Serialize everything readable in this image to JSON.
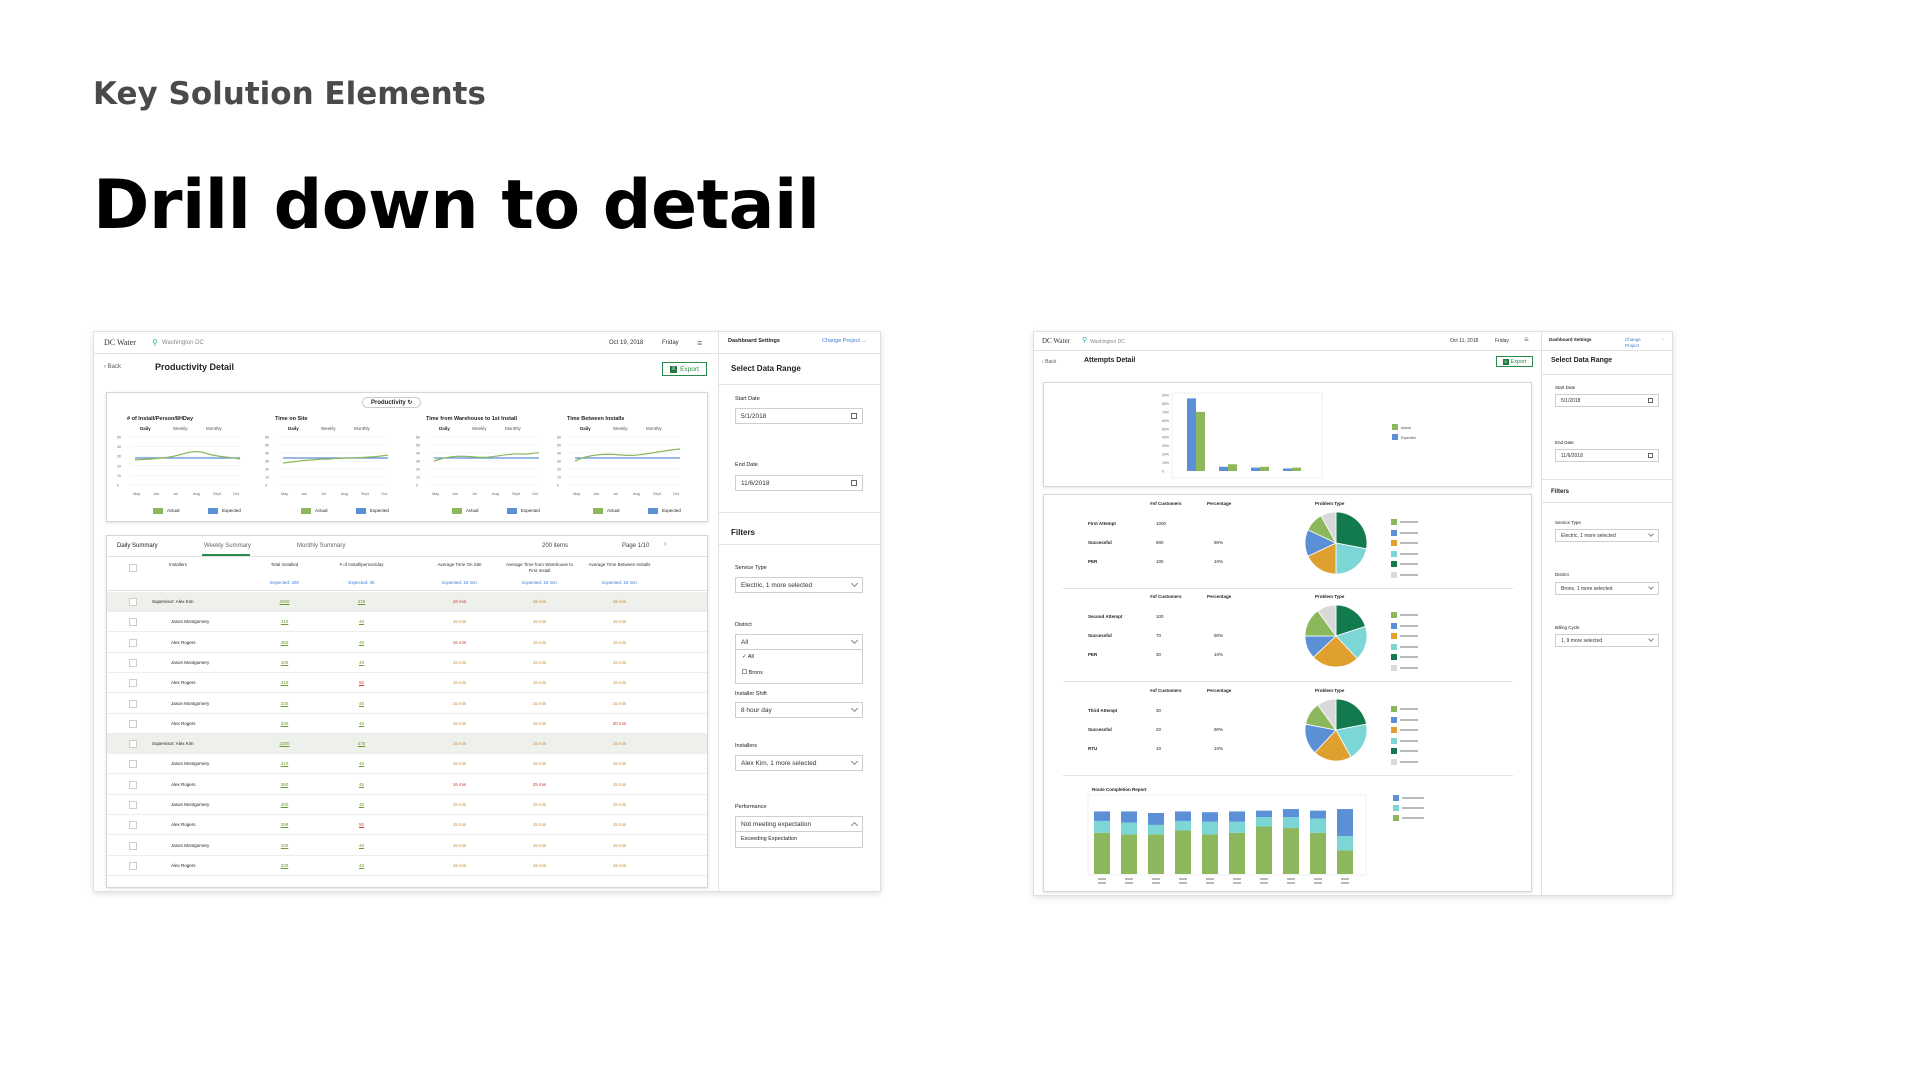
{
  "slide": {
    "kicker": "Key Solution Elements",
    "title": "Drill down to detail"
  },
  "colors": {
    "green": "#8db75c",
    "blue": "#5b8fd6",
    "teal": "#7dd6d6",
    "orange": "#e0a030",
    "darkgreen": "#127a4d",
    "grey": "#d9d9d9"
  },
  "productivity": {
    "app_name": "DC Water",
    "location": "Washington DC",
    "date": "Oct 19, 2018",
    "day": "Friday",
    "back": "Back",
    "page_title": "Productivity Detail",
    "export": "Export",
    "chip": "Productivity",
    "charts": [
      {
        "title": "# of Install/Person/8HDay",
        "tabs": [
          "Daily",
          "Weekly",
          "Monthly"
        ],
        "yticks": [
          "50",
          "40",
          "30",
          "20",
          "10",
          "0"
        ],
        "xticks": [
          "May",
          "Jun",
          "Jul",
          "Aug",
          "Sept",
          "Oct"
        ],
        "legend": [
          "Actual",
          "Expected"
        ]
      },
      {
        "title": "Time on Site",
        "tabs": [
          "Daily",
          "Weekly",
          "Monthly"
        ],
        "yticks": [
          "60",
          "50",
          "40",
          "30",
          "20",
          "10",
          "0"
        ],
        "xticks": [
          "May",
          "Jun",
          "Jul",
          "Aug",
          "Sept",
          "Oct"
        ],
        "legend": [
          "Actual",
          "Expected"
        ]
      },
      {
        "title": "Time from Warehouse to 1st Install",
        "tabs": [
          "Daily",
          "Weekly",
          "Monthly"
        ],
        "yticks": [
          "60",
          "50",
          "40",
          "30",
          "20",
          "10",
          "0"
        ],
        "xticks": [
          "May",
          "Jun",
          "Jul",
          "Aug",
          "Sept",
          "Oct"
        ],
        "legend": [
          "Actual",
          "Expected"
        ]
      },
      {
        "title": "Time Between Installs",
        "tabs": [
          "Daily",
          "Weekly",
          "Monthly"
        ],
        "yticks": [
          "60",
          "50",
          "40",
          "30",
          "20",
          "10",
          "0"
        ],
        "xticks": [
          "May",
          "Jun",
          "Jul",
          "Aug",
          "Sept",
          "Oct"
        ],
        "legend": [
          "Actual",
          "Expected"
        ]
      }
    ],
    "table": {
      "tabs": [
        "Daily Summary",
        "Weekly Summary",
        "Monthly Summary"
      ],
      "items": "200 items",
      "page": "Page 1/10",
      "headers": [
        "Installers",
        "Total Installed",
        "# of Install/person/day",
        "Average Time On Site",
        "Average Time from Warehouse to First Install",
        "Average Time Between Installs"
      ],
      "expected": [
        "",
        "Expected: 400",
        "Expected: 45",
        "Expected: 15 min",
        "Expected: 15 min",
        "Expected: 15 min"
      ],
      "rows": [
        {
          "name": "Supervisor: Alex Kim",
          "total": "2000",
          "perday": "475",
          "onsite": "16 min",
          "warehouse": "15 min",
          "between": "15 min",
          "sup": true,
          "onsite_c": "red",
          "wh_c": "org",
          "bt_c": "org"
        },
        {
          "name": "Jason Montgomery",
          "total": "410",
          "perday": "45",
          "onsite": "15 min",
          "warehouse": "15 min",
          "between": "15 min",
          "sup": false,
          "onsite_c": "org",
          "wh_c": "org",
          "bt_c": "org"
        },
        {
          "name": "Alex Rogers",
          "total": "350",
          "perday": "45",
          "onsite": "16 min",
          "warehouse": "15 min",
          "between": "15 min",
          "sup": false,
          "onsite_c": "red",
          "wh_c": "org",
          "bt_c": "org"
        },
        {
          "name": "Jason Montgomery",
          "total": "400",
          "perday": "45",
          "onsite": "15 min",
          "warehouse": "15 min",
          "between": "15 min",
          "sup": false,
          "onsite_c": "org",
          "wh_c": "org",
          "bt_c": "org"
        },
        {
          "name": "Alex Rogers",
          "total": "410",
          "perday": "52",
          "onsite": "15 min",
          "warehouse": "15 min",
          "between": "15 min",
          "sup": false,
          "onsite_c": "org",
          "wh_c": "org",
          "bt_c": "org",
          "perday_c": "red"
        },
        {
          "name": "Jason Montgomery",
          "total": "330",
          "perday": "45",
          "onsite": "15 min",
          "warehouse": "15 min",
          "between": "15 min",
          "sup": false,
          "onsite_c": "org",
          "wh_c": "org",
          "bt_c": "org"
        },
        {
          "name": "Alex Rogers",
          "total": "330",
          "perday": "45",
          "onsite": "15 min",
          "warehouse": "15 min",
          "between": "20 min",
          "sup": false,
          "onsite_c": "org",
          "wh_c": "org",
          "bt_c": "red"
        },
        {
          "name": "Supervisor: Alex Kim",
          "total": "2200",
          "perday": "475",
          "onsite": "15 min",
          "warehouse": "15 min",
          "between": "15 min",
          "sup": true,
          "onsite_c": "org",
          "wh_c": "org",
          "bt_c": "org"
        },
        {
          "name": "Jason Montgomery",
          "total": "410",
          "perday": "45",
          "onsite": "15 min",
          "warehouse": "15 min",
          "between": "15 min",
          "sup": false,
          "onsite_c": "org",
          "wh_c": "org",
          "bt_c": "org"
        },
        {
          "name": "Alex Rogers",
          "total": "350",
          "perday": "45",
          "onsite": "16 min",
          "warehouse": "25 min",
          "between": "15 min",
          "sup": false,
          "onsite_c": "red",
          "wh_c": "red",
          "bt_c": "org"
        },
        {
          "name": "Jason Montgomery",
          "total": "400",
          "perday": "45",
          "onsite": "15 min",
          "warehouse": "15 min",
          "between": "15 min",
          "sup": false,
          "onsite_c": "org",
          "wh_c": "org",
          "bt_c": "org"
        },
        {
          "name": "Alex Rogers",
          "total": "399",
          "perday": "52",
          "onsite": "15 min",
          "warehouse": "15 min",
          "between": "15 min",
          "sup": false,
          "onsite_c": "org",
          "wh_c": "org",
          "bt_c": "org",
          "perday_c": "red"
        },
        {
          "name": "Jason Montgomery",
          "total": "330",
          "perday": "45",
          "onsite": "15 min",
          "warehouse": "15 min",
          "between": "15 min",
          "sup": false,
          "onsite_c": "org",
          "wh_c": "org",
          "bt_c": "org"
        },
        {
          "name": "Alex Rogers",
          "total": "330",
          "perday": "45",
          "onsite": "15 min",
          "warehouse": "15 min",
          "between": "15 min",
          "sup": false,
          "onsite_c": "org",
          "wh_c": "org",
          "bt_c": "org"
        }
      ]
    },
    "sidebar": {
      "title": "Dashboard Settings",
      "change_project": "Change Project",
      "range_title": "Select Data Range",
      "start_label": "Start Date",
      "start_value": "5/1/2018",
      "end_label": "End Date",
      "end_value": "11/6/2018",
      "filters_title": "Filters",
      "service_label": "Service Type",
      "service_value": "Electric, 1 more selected",
      "district_label": "District",
      "district_value": "All",
      "district_options": [
        "All",
        "Bronx"
      ],
      "shift_label": "Installer Shift",
      "shift_value": "8 hour day",
      "installers_label": "Installers",
      "installers_value": "Alex Kim, 1 more selected",
      "performance_label": "Performance",
      "performance_value": "Not meeting expectation",
      "performance_options": [
        "Exceeding Expectation"
      ]
    }
  },
  "attempts": {
    "app_name": "DC Water",
    "location": "Washington DC",
    "date": "Oct 11, 2018",
    "day": "Friday",
    "back": "Back",
    "page_title": "Attempts Detail",
    "export": "Export",
    "top_chart": {
      "yticks": [
        "90%",
        "80%",
        "70%",
        "60%",
        "50%",
        "40%",
        "30%",
        "20%",
        "10%",
        "0"
      ],
      "legend": [
        "Actual",
        "Expected"
      ]
    },
    "sections": [
      {
        "col1": "#of Customers",
        "col2": "Percentage",
        "chart_title": "Problem Type",
        "rows": [
          [
            "First Attempt",
            "1000",
            ""
          ],
          [
            "Successful",
            "900",
            "90%"
          ],
          [
            "PER",
            "100",
            "10%"
          ]
        ]
      },
      {
        "col1": "#of Customers",
        "col2": "Percentage",
        "chart_title": "Problem Type",
        "rows": [
          [
            "Second Attempt",
            "100",
            ""
          ],
          [
            "Successful",
            "70",
            "90%"
          ],
          [
            "PER",
            "30",
            "10%"
          ]
        ]
      },
      {
        "col1": "#of Customers",
        "col2": "Percentage",
        "chart_title": "Problem Type",
        "rows": [
          [
            "Third Attempt",
            "30",
            ""
          ],
          [
            "Successful",
            "20",
            "90%"
          ],
          [
            "RTU",
            "10",
            "10%"
          ]
        ]
      }
    ],
    "route_title": "Route Completion Report",
    "sidebar": {
      "title": "Dashboard Settings",
      "change_project": "Change Project",
      "range_title": "Select Data Range",
      "start_label": "Start Date",
      "start_value": "5/1/2018",
      "end_label": "End Date",
      "end_value": "11/6/2018",
      "filters_title": "Filters",
      "service_label": "Service Type",
      "service_value": "Electric, 1 more selected",
      "district_label": "District",
      "district_value": "Bronx, 1 more selected",
      "billing_label": "Billing Cycle",
      "billing_value": "1, 9 more selected"
    }
  }
}
